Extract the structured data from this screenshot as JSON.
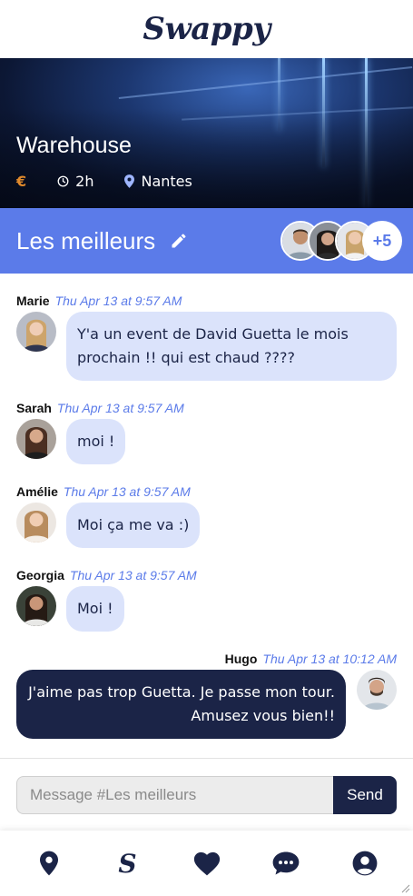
{
  "app": {
    "logo": "Swappy"
  },
  "venue": {
    "name": "Warehouse",
    "price": "€",
    "duration": "2h",
    "location": "Nantes"
  },
  "group": {
    "name": "Les meilleurs",
    "extra_members": "+5"
  },
  "messages": [
    {
      "author": "Marie",
      "time": "Thu Apr 13 at 9:57 AM",
      "text": "Y'a un event de David Guetta le mois prochain !! qui est chaud ????",
      "mine": false
    },
    {
      "author": "Sarah",
      "time": "Thu Apr 13 at 9:57 AM",
      "text": "moi !",
      "mine": false
    },
    {
      "author": "Amélie",
      "time": "Thu Apr 13 at 9:57 AM",
      "text": "Moi ça me va :)",
      "mine": false
    },
    {
      "author": "Georgia",
      "time": "Thu Apr 13 at 9:57 AM",
      "text": "Moi !",
      "mine": false
    },
    {
      "author": "Hugo",
      "time": "Thu Apr 13 at 10:12 AM",
      "text": "J'aime pas trop Guetta. Je passe mon tour. Amusez vous bien!!",
      "mine": true
    }
  ],
  "composer": {
    "placeholder": "Message #Les meilleurs",
    "send_label": "Send"
  },
  "nav": [
    {
      "icon": "map-pin-icon"
    },
    {
      "icon": "swappy-s-icon",
      "label": "S"
    },
    {
      "icon": "heart-icon"
    },
    {
      "icon": "chat-bubble-icon"
    },
    {
      "icon": "user-circle-icon"
    }
  ],
  "colors": {
    "navy": "#1b2447",
    "accent": "#5b7be9",
    "bubble": "#dbe3fb",
    "price": "#e08a2c"
  }
}
